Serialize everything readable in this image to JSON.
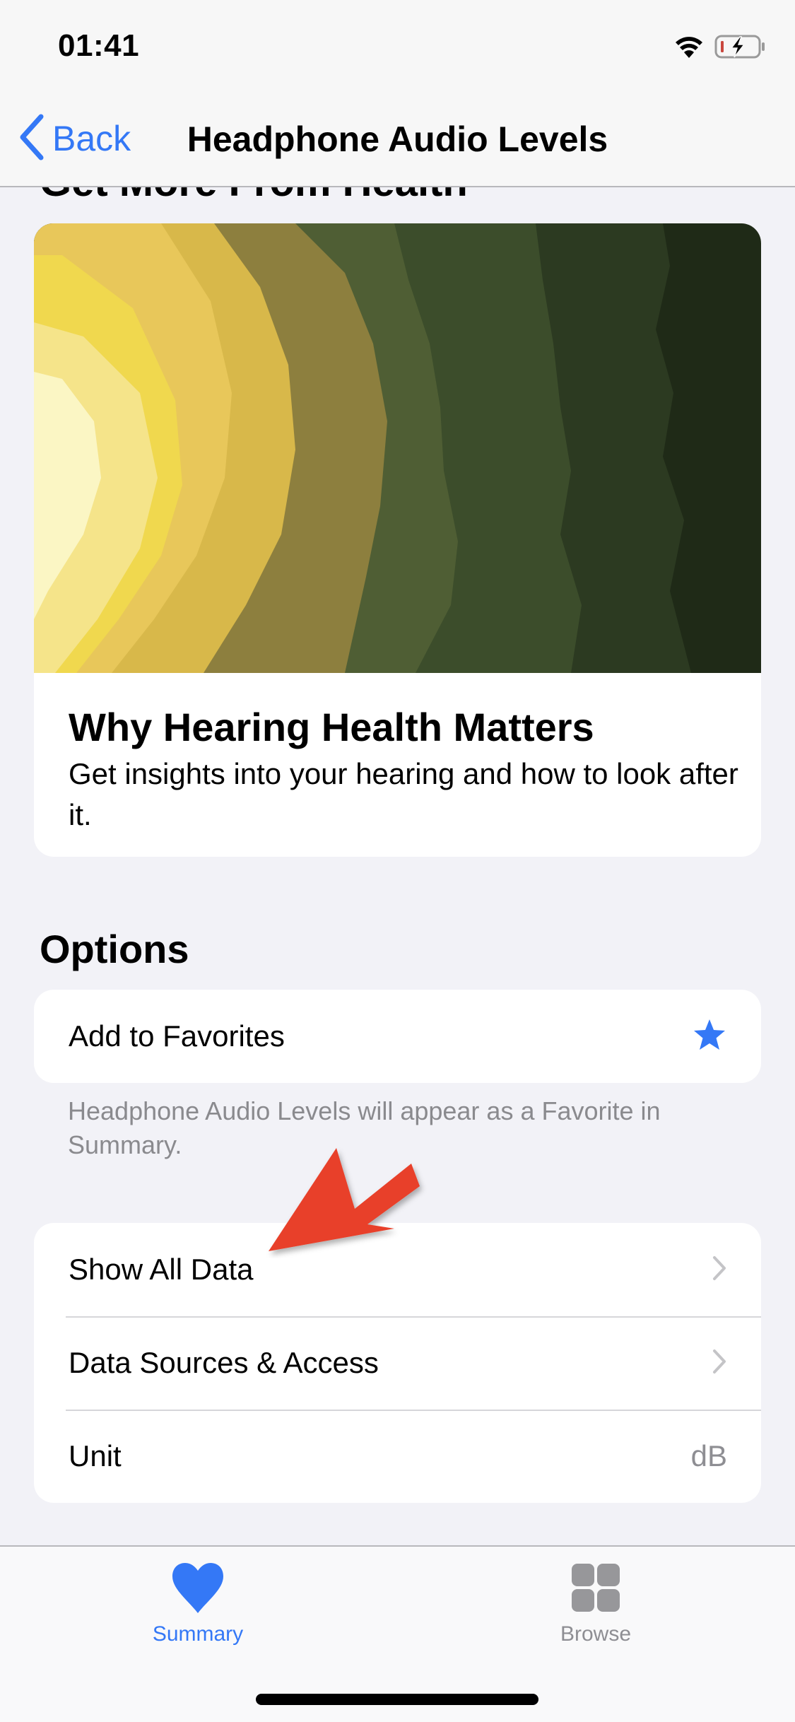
{
  "status_bar": {
    "time": "01:41",
    "wifi_icon": "wifi-icon",
    "battery_icon": "battery-charging-low-icon"
  },
  "nav": {
    "back_label": "Back",
    "title": "Headphone Audio Levels"
  },
  "partial_section_heading": "Get More From Health",
  "article": {
    "title": "Why Hearing Health Matters",
    "description": "Get insights into your hearing and how to look after it."
  },
  "options": {
    "heading": "Options",
    "favorite_row": {
      "label": "Add to Favorites",
      "icon": "star-icon",
      "favorited": true
    },
    "favorite_footnote": "Headphone Audio Levels will appear as a Favorite in Summary.",
    "rows": [
      {
        "label": "Show All Data",
        "accessory": "chevron-right-icon"
      },
      {
        "label": "Data Sources & Access",
        "accessory": "chevron-right-icon"
      },
      {
        "label": "Unit",
        "value": "dB"
      }
    ]
  },
  "tab_bar": {
    "tabs": [
      {
        "label": "Summary",
        "icon": "heart-icon",
        "selected": true
      },
      {
        "label": "Browse",
        "icon": "grid-icon",
        "selected": false
      }
    ]
  },
  "colors": {
    "accent": "#3478f6",
    "background": "#f2f2f7",
    "secondary_text": "#8e8e93",
    "annotation_arrow": "#e8402a"
  }
}
